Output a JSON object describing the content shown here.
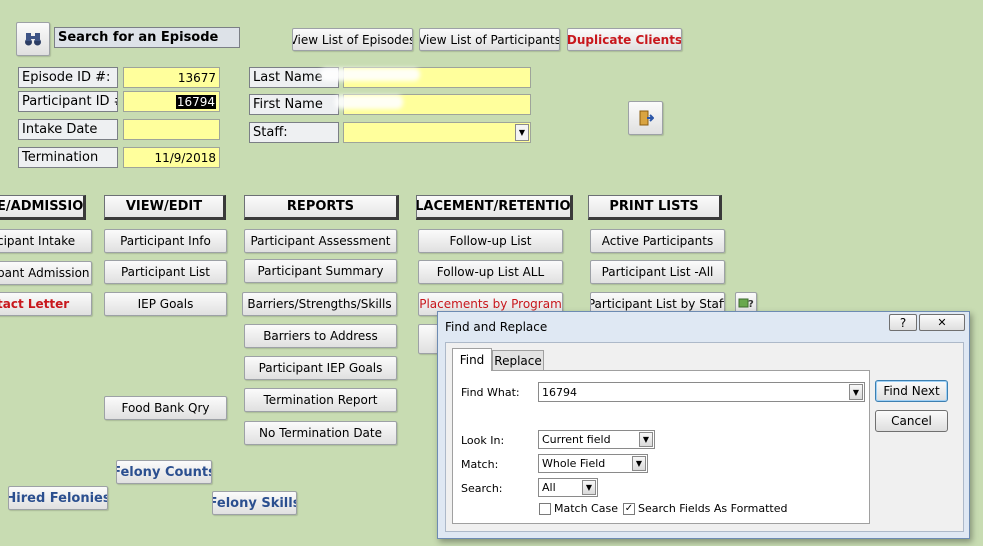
{
  "search": {
    "title": "Search for an Episode",
    "icon": "binoculars-icon"
  },
  "top_buttons": {
    "view_episodes": "View List of Episodes",
    "view_participants": "View List of Participants",
    "duplicate_clients": "Duplicate Clients"
  },
  "fields": {
    "episode_id_label": "Episode ID #:",
    "episode_id_value": "13677",
    "participant_id_label": "Participant ID #",
    "participant_id_value": "16794",
    "intake_date_label": "Intake Date",
    "intake_date_value": "",
    "termination_label": "Termination",
    "termination_value": "11/9/2018",
    "last_name_label": "Last Name",
    "first_name_label": "First Name",
    "staff_label": "Staff:",
    "staff_value": ""
  },
  "headers": {
    "intake_admission": "E/ADMISSION",
    "view_edit": "VIEW/EDIT",
    "reports": "REPORTS",
    "placement_retention": "PLACEMENT/RETENTION",
    "print_lists": "PRINT LISTS"
  },
  "col_intake": [
    "cipant Intake",
    "pant Admission",
    "tact Letter"
  ],
  "col_view": [
    "Participant Info",
    "Participant List",
    "IEP Goals",
    "Food Bank Qry"
  ],
  "col_reports": [
    "Participant Assessment",
    "Participant Summary",
    "Barriers/Strengths/Skills",
    "Barriers to Address",
    "Participant IEP Goals",
    "Termination Report",
    "No Termination Date"
  ],
  "col_placement": [
    "Follow-up List",
    "Follow-up List ALL",
    "Placements by Program"
  ],
  "col_print": [
    "Active Participants",
    "Participant List -All",
    "Participant List by Staff"
  ],
  "felony": {
    "counts": "Felony Counts",
    "hired": "Hired Felonies",
    "skills": "Felony Skills"
  },
  "dialog": {
    "title": "Find and Replace",
    "help": "?",
    "close": "✕",
    "tabs": [
      "Find",
      "Replace"
    ],
    "find_what_label": "Find What:",
    "find_what_value": "16794",
    "look_in_label": "Look In:",
    "look_in_value": "Current field",
    "match_label": "Match:",
    "match_value": "Whole Field",
    "search_label": "Search:",
    "search_value": "All",
    "match_case_label": "Match Case",
    "match_case_checked": false,
    "search_formatted_label": "Search Fields As Formatted",
    "search_formatted_checked": true,
    "find_next": "Find Next",
    "cancel": "Cancel"
  },
  "colors": {
    "background": "#c8dcb2",
    "field_yellow": "#ffff9c",
    "red_text": "#c8171c",
    "blue_text": "#2b4f8f"
  }
}
